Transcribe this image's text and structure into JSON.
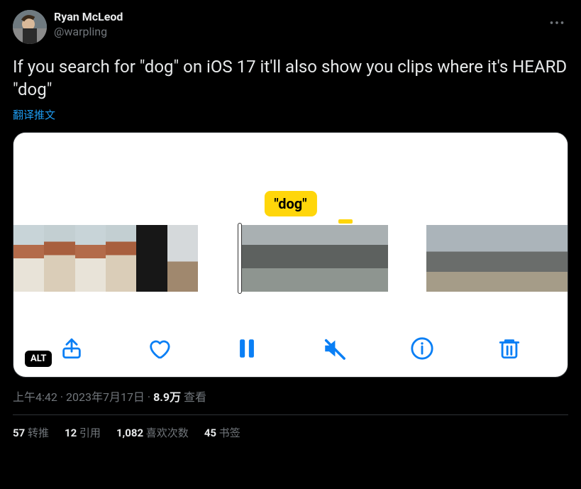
{
  "user": {
    "display_name": "Ryan McLeod",
    "handle": "@warpling"
  },
  "tweet_text": "If you search for \"dog\" on iOS 17 it'll also show you clips where it's HEARD \"dog\"",
  "translate_label": "翻译推文",
  "media": {
    "search_term": "\"dog\"",
    "alt_badge": "ALT"
  },
  "meta": {
    "time": "上午4:42",
    "date": "2023年7月17日",
    "views_count": "8.9万",
    "views_label": "查看"
  },
  "stats": {
    "retweets_count": "57",
    "retweets_label": "转推",
    "quotes_count": "12",
    "quotes_label": "引用",
    "likes_count": "1,082",
    "likes_label": "喜欢次数",
    "bookmarks_count": "45",
    "bookmarks_label": "书签"
  }
}
